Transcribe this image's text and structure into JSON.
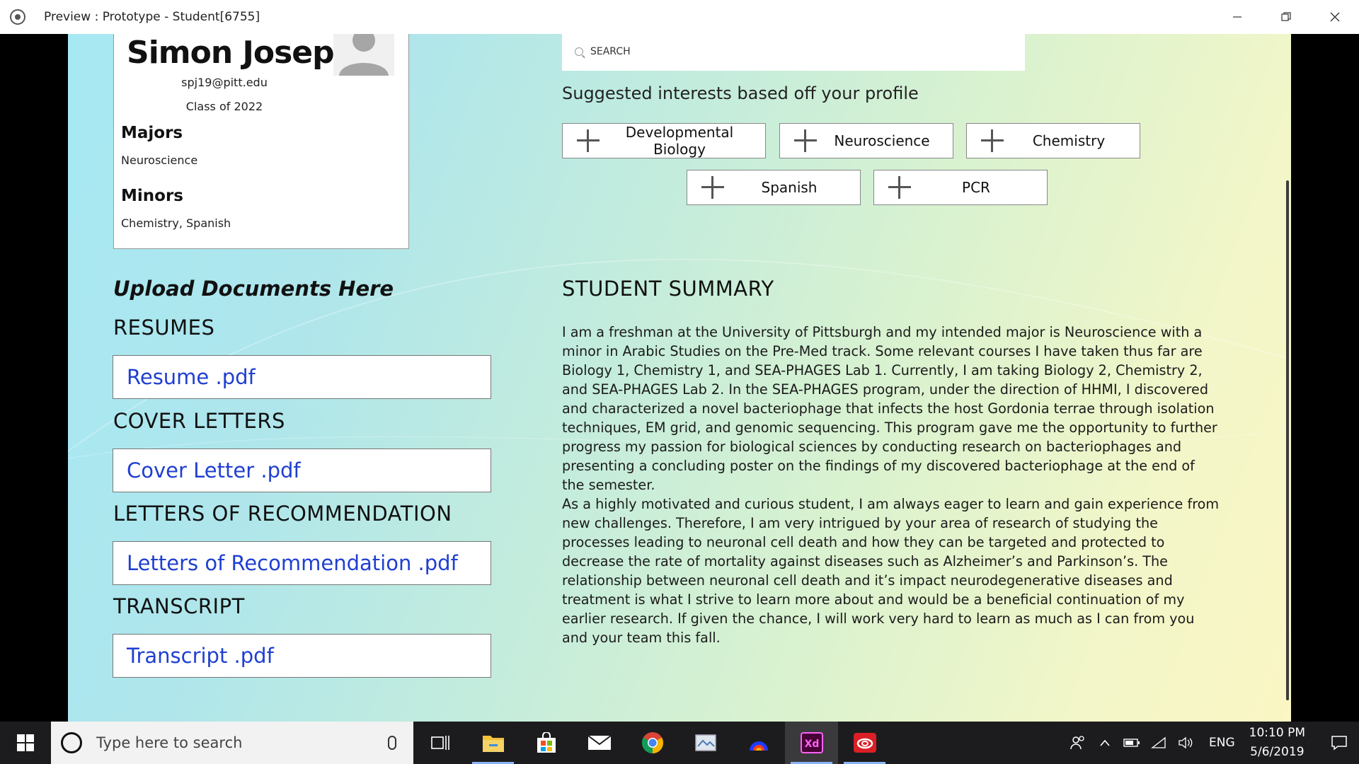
{
  "window": {
    "title": "Preview : Prototype - Student[6755]"
  },
  "profile": {
    "name": "Simon Joseph",
    "email": "spj19@pitt.edu",
    "class_year": "Class of 2022",
    "majors_heading": "Majors",
    "majors": "Neuroscience",
    "minors_heading": "Minors",
    "minors": "Chemistry, Spanish"
  },
  "uploads": {
    "title": "Upload Documents Here",
    "sections": [
      {
        "heading": "RESUMES",
        "file": "Resume .pdf"
      },
      {
        "heading": "COVER LETTERS",
        "file": "Cover Letter .pdf"
      },
      {
        "heading": "LETTERS OF RECOMMENDATION",
        "file": "Letters of Recommendation .pdf"
      },
      {
        "heading": "TRANSCRIPT",
        "file": "Transcript .pdf"
      }
    ]
  },
  "search": {
    "placeholder": "SEARCH"
  },
  "interests": {
    "title": "Suggested interests based off your profile",
    "items": [
      "Developmental Biology",
      "Neuroscience",
      "Chemistry",
      "Spanish",
      "PCR"
    ]
  },
  "summary": {
    "title": "STUDENT SUMMARY",
    "paragraphs": [
      "I am a freshman at the University of Pittsburgh and my intended major is Neuroscience with a minor in Arabic Studies on the Pre-Med track. Some relevant courses I have taken thus far are Biology 1, Chemistry 1, and SEA-PHAGES Lab 1. Currently, I am taking Biology 2, Chemistry 2, and SEA-PHAGES Lab 2. In the SEA-PHAGES program, under the direction of HHMI, I discovered and characterized a novel bacteriophage that infects the host Gordonia terrae through isolation techniques, EM grid, and genomic sequencing. This program gave me the opportunity to further progress my passion for biological sciences by conducting research on bacteriophages and presenting a concluding poster on the findings of my discovered bacteriophage at the end of the semester.",
      "As a highly motivated and curious student, I am always eager to learn and gain experience from new challenges. Therefore, I am very intrigued by your area of research of studying the processes leading to neuronal cell death and how they can be targeted and protected to decrease the rate of mortality against diseases such as Alzheimer’s and Parkinson’s. The relationship between neuronal cell death and it’s impact neurodegenerative diseases and treatment is what I strive to learn more about and would be a beneficial continuation of my earlier research. If given the chance, I will work very hard to learn as much as I can from you and your team this fall."
    ]
  },
  "taskbar": {
    "search_placeholder": "Type here to search",
    "apps": [
      "task-view-icon",
      "file-explorer-icon",
      "store-icon",
      "mail-icon",
      "chrome-icon",
      "photos-icon",
      "app-icon",
      "adobe-xd-icon",
      "creative-cloud-icon"
    ],
    "language": "ENG",
    "time": "10:10 PM",
    "date": "5/6/2019"
  },
  "colors": {
    "link": "#1f3fd1",
    "taskbar": "#1c1c1e",
    "xd": "#ff61f6",
    "creative_cloud": "#da1f26"
  }
}
